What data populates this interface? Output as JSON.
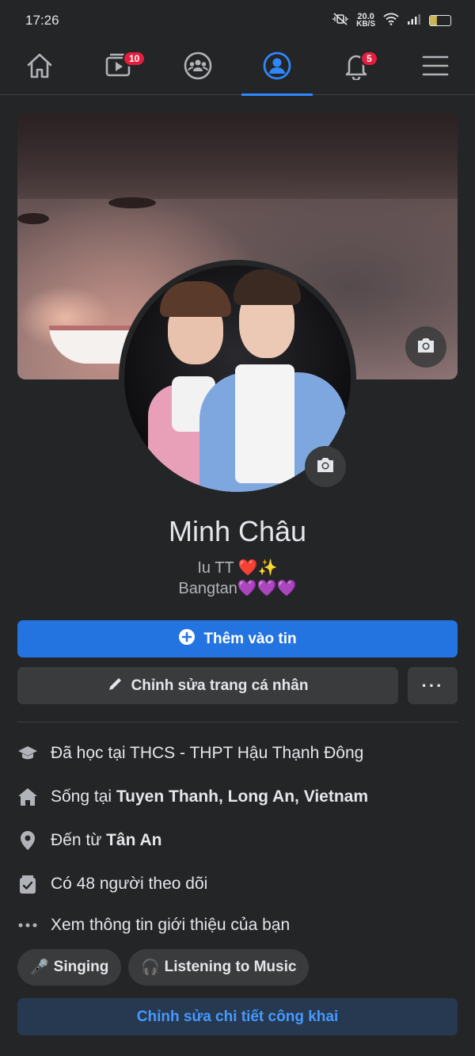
{
  "status_bar": {
    "time": "17:26",
    "net_speed_value": "20.0",
    "net_speed_unit": "KB/S",
    "battery": "34"
  },
  "nav": {
    "items": [
      {
        "name": "home",
        "badge": null
      },
      {
        "name": "watch",
        "badge": "10"
      },
      {
        "name": "groups",
        "badge": null
      },
      {
        "name": "profile",
        "badge": null,
        "active": true
      },
      {
        "name": "notifications",
        "badge": "5"
      },
      {
        "name": "menu",
        "badge": null
      }
    ]
  },
  "profile": {
    "name": "Minh Châu",
    "bio_line1": "Iu TT ❤️✨",
    "bio_line2": "Bangtan💜💜💜"
  },
  "actions": {
    "add_story": "Thêm vào tin",
    "edit_profile": "Chỉnh sửa trang cá nhân",
    "more": "···"
  },
  "intro": {
    "education": "Đã học tại THCS - THPT Hậu Thạnh Đông",
    "lives_prefix": "Sống tại ",
    "lives_place": "Tuyen Thanh, Long An, Vietnam",
    "from_prefix": "Đến từ ",
    "from_place": "Tân An",
    "followers": "Có 48 người theo dõi",
    "see_about": "Xem thông tin giới thiệu của bạn"
  },
  "hobbies": [
    {
      "icon": "🎤",
      "label": "Singing"
    },
    {
      "icon": "🎧",
      "label": "Listening to Music"
    }
  ],
  "edit_details": "Chỉnh sửa chi tiết công khai",
  "colors": {
    "background": "#242526",
    "primary": "#2374e1",
    "accent_active": "#2d88ff",
    "badge": "#e41e3f",
    "secondary_button": "#3a3b3c",
    "edit_details_bg": "#263951",
    "edit_details_text": "#4599ff"
  }
}
